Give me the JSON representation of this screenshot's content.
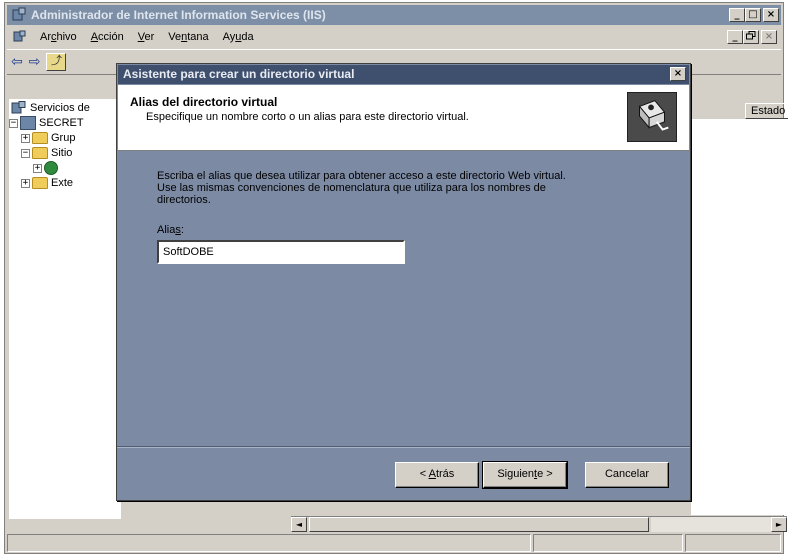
{
  "main": {
    "title": "Administrador de Internet Information Services (IIS)",
    "caption_buttons": [
      "_",
      "□",
      "×"
    ],
    "mdi_buttons": [
      "_",
      "ð",
      "×"
    ]
  },
  "menu": {
    "items": [
      {
        "pre": "Ar",
        "u": "c",
        "post": "hivo"
      },
      {
        "pre": "",
        "u": "A",
        "post": "cción"
      },
      {
        "pre": "",
        "u": "V",
        "post": "er"
      },
      {
        "pre": "Ve",
        "u": "n",
        "post": "tana"
      },
      {
        "pre": "Ay",
        "u": "u",
        "post": "da"
      }
    ]
  },
  "toolbar": {
    "back": "⇦",
    "forward": "⇨",
    "up": "⤴"
  },
  "tree": {
    "items": [
      {
        "label": "Servicios de",
        "expander": ""
      },
      {
        "label": "SECRET",
        "expander": "−"
      },
      {
        "label": "Grup",
        "expander": "+"
      },
      {
        "label": "Sitio",
        "expander": "−"
      },
      {
        "label": "",
        "expander": "+"
      },
      {
        "label": "Exte",
        "expander": "+"
      }
    ]
  },
  "list": {
    "column_estado": "Estado"
  },
  "scrollbar": {
    "left": "◄",
    "right": "►"
  },
  "wizard": {
    "title": "Asistente para crear un directorio virtual",
    "close": "×",
    "header_title": "Alias del directorio virtual",
    "header_subtitle": "Especifique un nombre corto o un alias para este directorio virtual.",
    "body_line1": "Escriba el alias que desea utilizar para obtener acceso a este directorio Web virtual.",
    "body_line2": "Use las mismas convenciones de nomenclatura que utiliza para los nombres de",
    "body_line3": "directorios.",
    "alias_label_pre": "Alia",
    "alias_label_u": "s",
    "alias_label_post": ":",
    "alias_value": "SoftDOBE",
    "back_pre": "< ",
    "back_u": "A",
    "back_post": "trás",
    "next_pre": "Siguien",
    "next_u": "t",
    "next_post": "e >",
    "cancel": "Cancelar"
  },
  "colors": {
    "titlebar": "#7d8fa6",
    "wizard_bg": "#7c8aa4",
    "wizard_title": "#3f4f6e",
    "face": "#d4d0c8"
  }
}
